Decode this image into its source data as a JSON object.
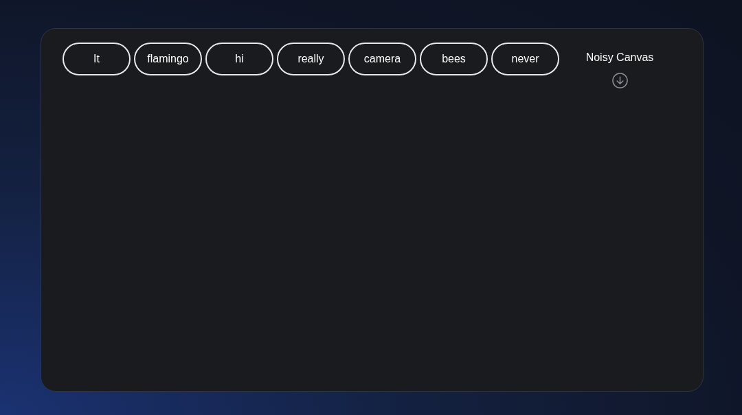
{
  "word_chips": [
    {
      "label": "It"
    },
    {
      "label": "flamingo"
    },
    {
      "label": "hi"
    },
    {
      "label": "really"
    },
    {
      "label": "camera"
    },
    {
      "label": "bees"
    },
    {
      "label": "never"
    }
  ],
  "canvas_panel": {
    "title": "Noisy Canvas"
  }
}
